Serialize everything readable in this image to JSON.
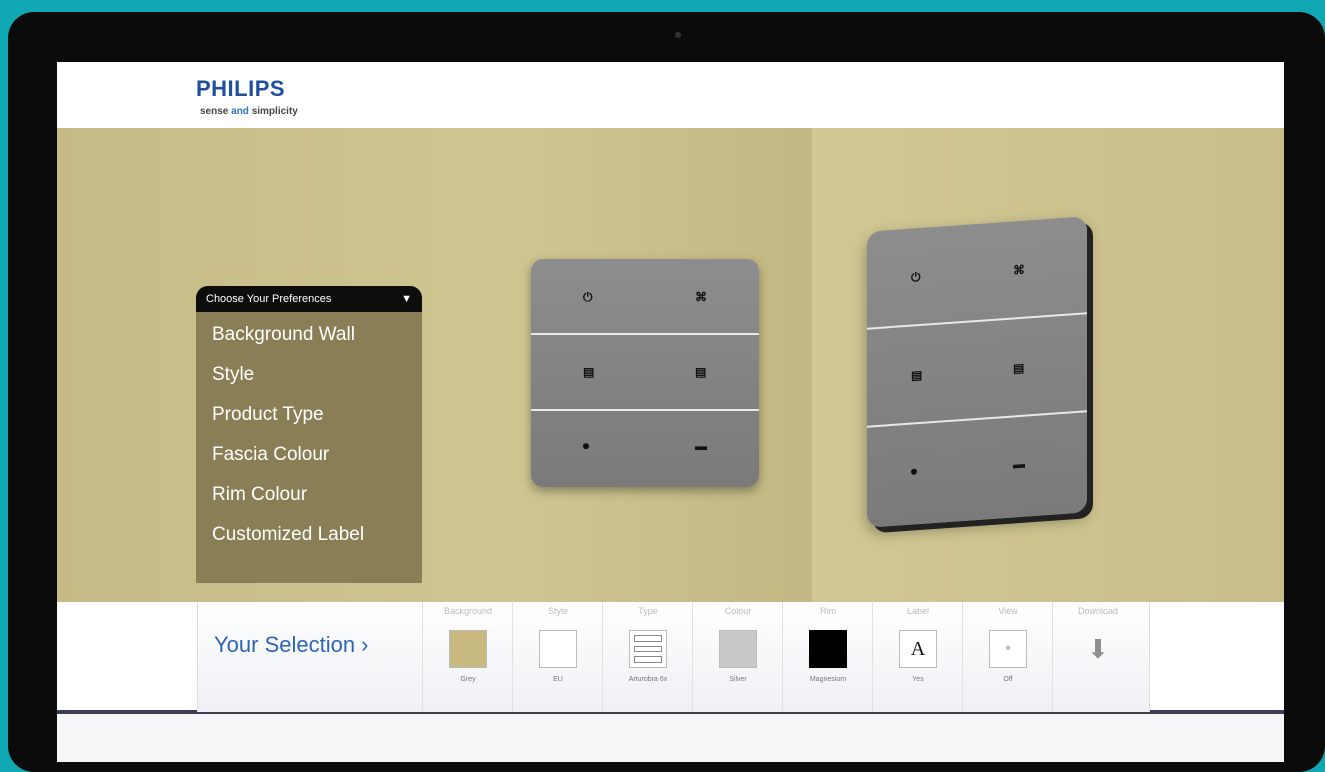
{
  "brand": {
    "name": "PHILIPS",
    "tagline_pre": "sense",
    "tagline_mid": "and",
    "tagline_post": "simplicity"
  },
  "preferences": {
    "header": "Choose Your Preferences",
    "arrow": "▼",
    "items": [
      "Background Wall",
      "Style",
      "Product Type",
      "Fascia Colour",
      "Rim Colour",
      "Customized Label"
    ]
  },
  "panel_icons": [
    "⏻",
    "⌘",
    "▤",
    "▤",
    "⏺",
    "▬"
  ],
  "selection": {
    "title": "Your Selection ›",
    "slots": [
      {
        "category": "Background",
        "value": "Grey",
        "swatch": "#c9bb7f"
      },
      {
        "category": "Style",
        "value": "EU",
        "swatch": "#ffffff"
      },
      {
        "category": "Type",
        "value": "Arturobra 6x",
        "swatch": "#ffffff"
      },
      {
        "category": "Colour",
        "value": "Silver",
        "swatch": "#c9c9c9"
      },
      {
        "category": "Rim",
        "value": "Magnesium",
        "swatch": "#000000"
      },
      {
        "category": "Label",
        "value": "Yes",
        "swatch": "#ffffff",
        "glyph": "A"
      },
      {
        "category": "View",
        "value": "Off",
        "swatch": "#ffffff",
        "glyph": "•"
      },
      {
        "category": "Download",
        "value": "",
        "glyph": "⬇"
      }
    ]
  }
}
